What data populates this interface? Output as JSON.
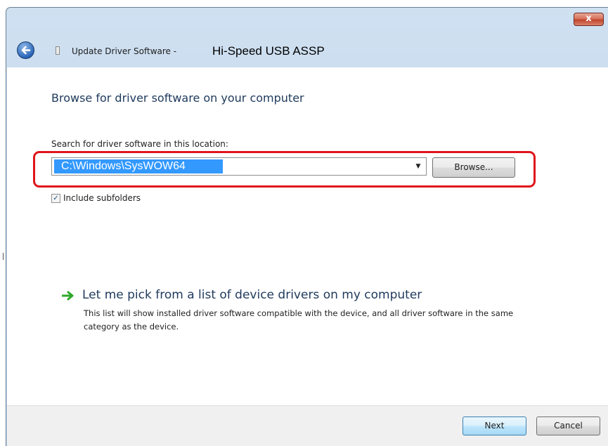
{
  "window": {
    "close_label": "x",
    "title_prefix": "Update Driver Software -",
    "device_name": "Hi-Speed USB ASSP"
  },
  "content": {
    "heading": "Browse for driver software on your computer",
    "location_label": "Search for driver software in this location:",
    "location_value": "C:\\Windows\\SysWOW64",
    "browse_label": "Browse...",
    "include_subfolders_label": "Include subfolders",
    "include_subfolders_checked": true,
    "pick_title": "Let me pick from a list of device drivers on my computer",
    "pick_description": "This list will show installed driver software compatible with the device, and all driver software in the same category as the device."
  },
  "footer": {
    "next_label": "Next",
    "cancel_label": "Cancel"
  },
  "colors": {
    "accent_heading": "#1e395b",
    "highlight_box": "#e0141b",
    "selection": "#3399ff",
    "pick_arrow": "#2da82a"
  },
  "icons": {
    "back": "back-arrow-icon",
    "device": "usb-device-icon",
    "pick": "green-arrow-icon",
    "dropdown": "chevron-down-icon"
  }
}
